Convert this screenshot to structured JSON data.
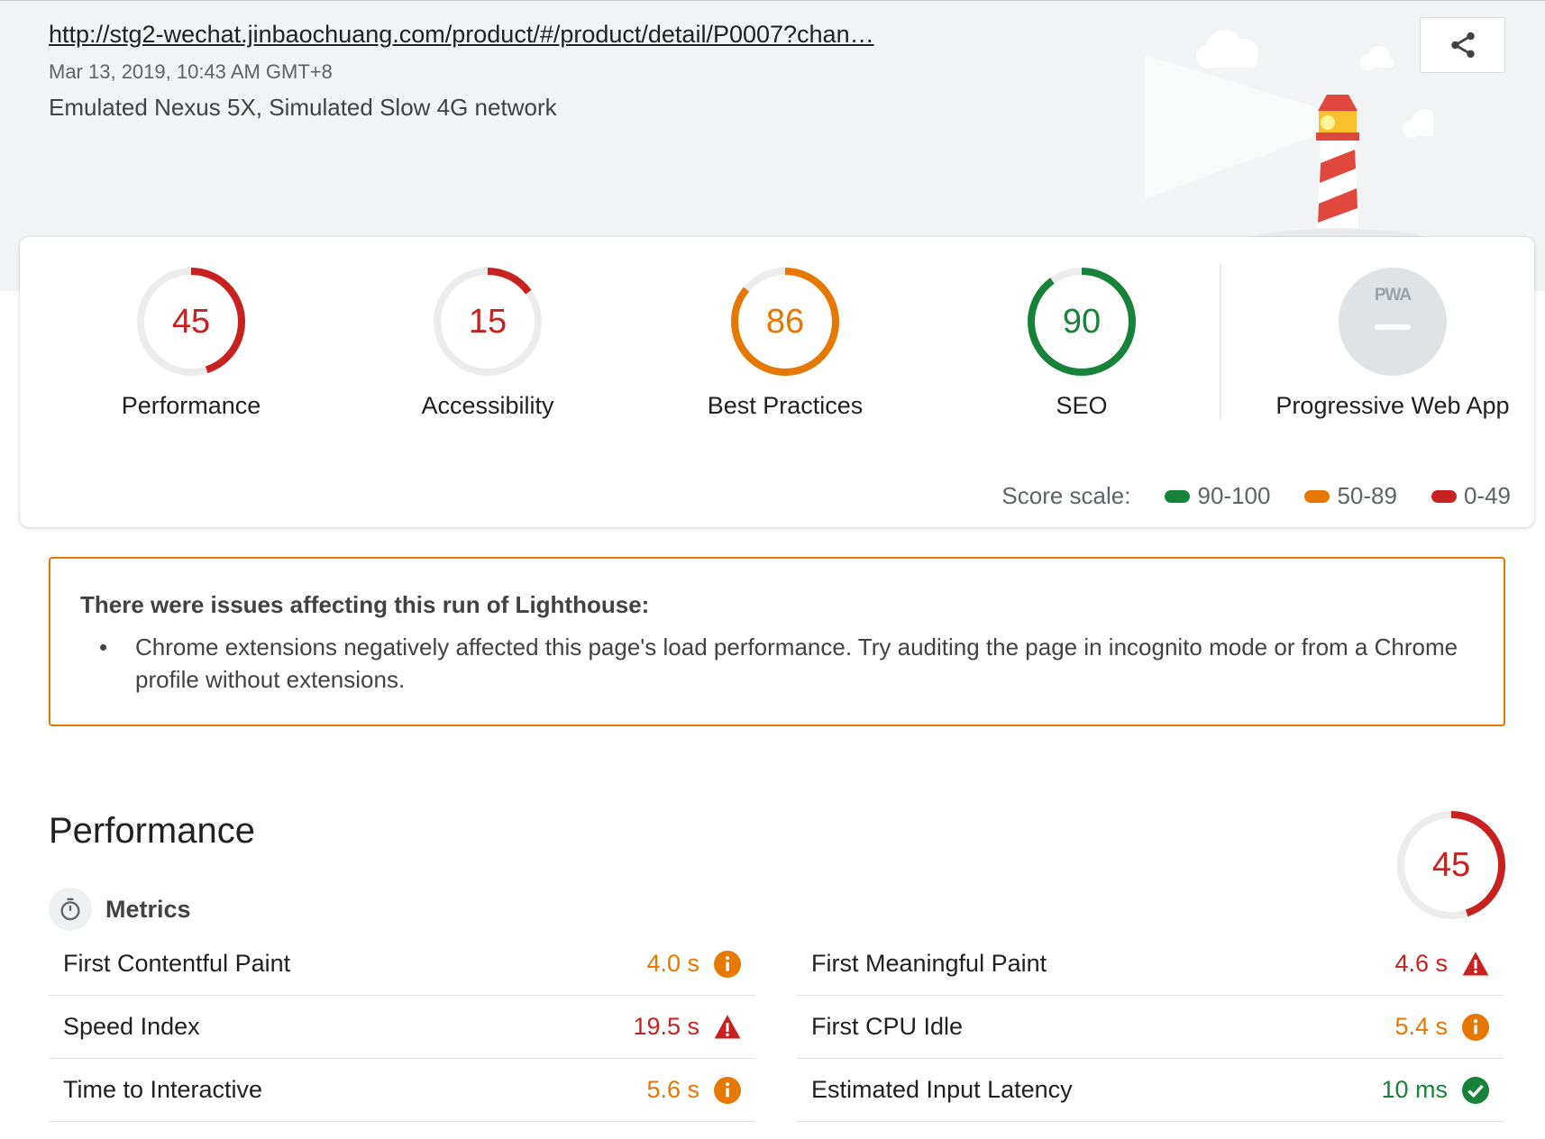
{
  "header": {
    "url": "http://stg2-wechat.jinbaochuang.com/product/#/product/detail/P0007?chan…",
    "date": "Mar 13, 2019, 10:43 AM GMT+8",
    "environment": "Emulated Nexus 5X, Simulated Slow 4G network",
    "share_icon": "share-icon"
  },
  "colors": {
    "pass": "#178239",
    "average": "#e67700",
    "fail": "#c7221f",
    "track": "#ececec",
    "pwa_gray": "#dfe3e6"
  },
  "scores": [
    {
      "label": "Performance",
      "value": 45,
      "rating": "fail"
    },
    {
      "label": "Accessibility",
      "value": 15,
      "rating": "fail"
    },
    {
      "label": "Best Practices",
      "value": 86,
      "rating": "average"
    },
    {
      "label": "SEO",
      "value": 90,
      "rating": "pass"
    }
  ],
  "pwa": {
    "label": "Progressive Web App",
    "badge": "PWA",
    "icon": "pwa-icon"
  },
  "scale": {
    "label": "Score scale:",
    "items": [
      {
        "range": "90-100",
        "rating": "pass"
      },
      {
        "range": "50-89",
        "rating": "average"
      },
      {
        "range": "0-49",
        "rating": "fail"
      }
    ]
  },
  "warning": {
    "title": "There were issues affecting this run of Lighthouse:",
    "items": [
      "Chrome extensions negatively affected this page's load performance. Try auditing the page in incognito mode or from a Chrome profile without extensions."
    ]
  },
  "performance": {
    "title": "Performance",
    "score": 45,
    "rating": "fail",
    "metrics_label": "Metrics",
    "metrics_icon": "timer-icon",
    "metrics": [
      {
        "name": "First Contentful Paint",
        "value": "4.0 s",
        "rating": "average",
        "icon": "info-icon"
      },
      {
        "name": "First Meaningful Paint",
        "value": "4.6 s",
        "rating": "fail",
        "icon": "warning-icon"
      },
      {
        "name": "Speed Index",
        "value": "19.5 s",
        "rating": "fail",
        "icon": "warning-icon"
      },
      {
        "name": "First CPU Idle",
        "value": "5.4 s",
        "rating": "average",
        "icon": "info-icon"
      },
      {
        "name": "Time to Interactive",
        "value": "5.6 s",
        "rating": "average",
        "icon": "info-icon"
      },
      {
        "name": "Estimated Input Latency",
        "value": "10 ms",
        "rating": "pass",
        "icon": "check-icon"
      }
    ]
  }
}
